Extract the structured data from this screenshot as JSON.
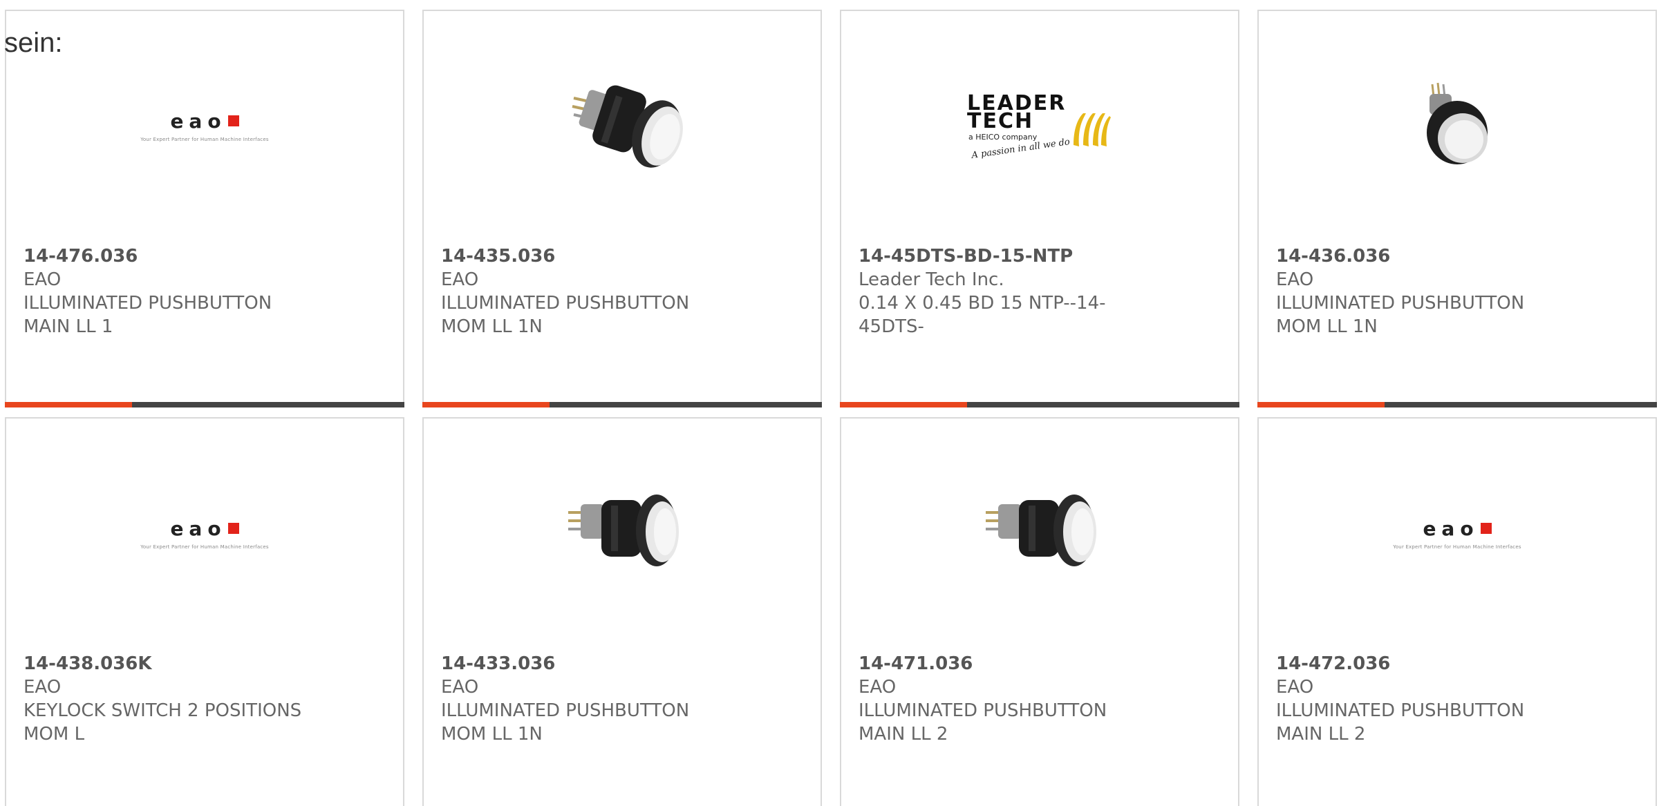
{
  "page": {
    "intro_text": "sein:"
  },
  "brand_colors": {
    "accent": "#e8461e",
    "bar_dark": "#444444",
    "text_gray": "#666666",
    "border": "#d9d9d9"
  },
  "logos": {
    "eao": {
      "word": "eao",
      "tagline": "Your Expert Partner for Human Machine Interfaces"
    },
    "leader_tech": {
      "line1": "LEADER",
      "line2": "TECH",
      "subtitle": "a HEICO company",
      "script": "A passion in all we do"
    }
  },
  "products": [
    {
      "part_number": "14-476.036",
      "manufacturer": "EAO",
      "description_line1": "ILLUMINATED PUSHBUTTON",
      "description_line2": "MAIN LL 1",
      "image": "eao-logo"
    },
    {
      "part_number": "14-435.036",
      "manufacturer": "EAO",
      "description_line1": "ILLUMINATED PUSHBUTTON",
      "description_line2": "MOM LL 1N",
      "image": "pushbutton-side"
    },
    {
      "part_number": "14-45DTS-BD-15-NTP",
      "manufacturer": "Leader Tech Inc.",
      "description_line1": "0.14 X 0.45 BD 15 NTP--14-",
      "description_line2": "45DTS-",
      "image": "leader-tech-logo"
    },
    {
      "part_number": "14-436.036",
      "manufacturer": "EAO",
      "description_line1": "ILLUMINATED PUSHBUTTON",
      "description_line2": "MOM LL 1N",
      "image": "pushbutton-front"
    },
    {
      "part_number": "14-438.036K",
      "manufacturer": "EAO",
      "description_line1": "KEYLOCK SWITCH 2 POSITIONS",
      "description_line2": "MOM L",
      "image": "eao-logo"
    },
    {
      "part_number": "14-433.036",
      "manufacturer": "EAO",
      "description_line1": "ILLUMINATED PUSHBUTTON",
      "description_line2": "MOM LL 1N",
      "image": "pushbutton-side"
    },
    {
      "part_number": "14-471.036",
      "manufacturer": "EAO",
      "description_line1": "ILLUMINATED PUSHBUTTON",
      "description_line2": "MAIN LL 2",
      "image": "pushbutton-side"
    },
    {
      "part_number": "14-472.036",
      "manufacturer": "EAO",
      "description_line1": "ILLUMINATED PUSHBUTTON",
      "description_line2": "MAIN LL 2",
      "image": "eao-logo"
    }
  ]
}
